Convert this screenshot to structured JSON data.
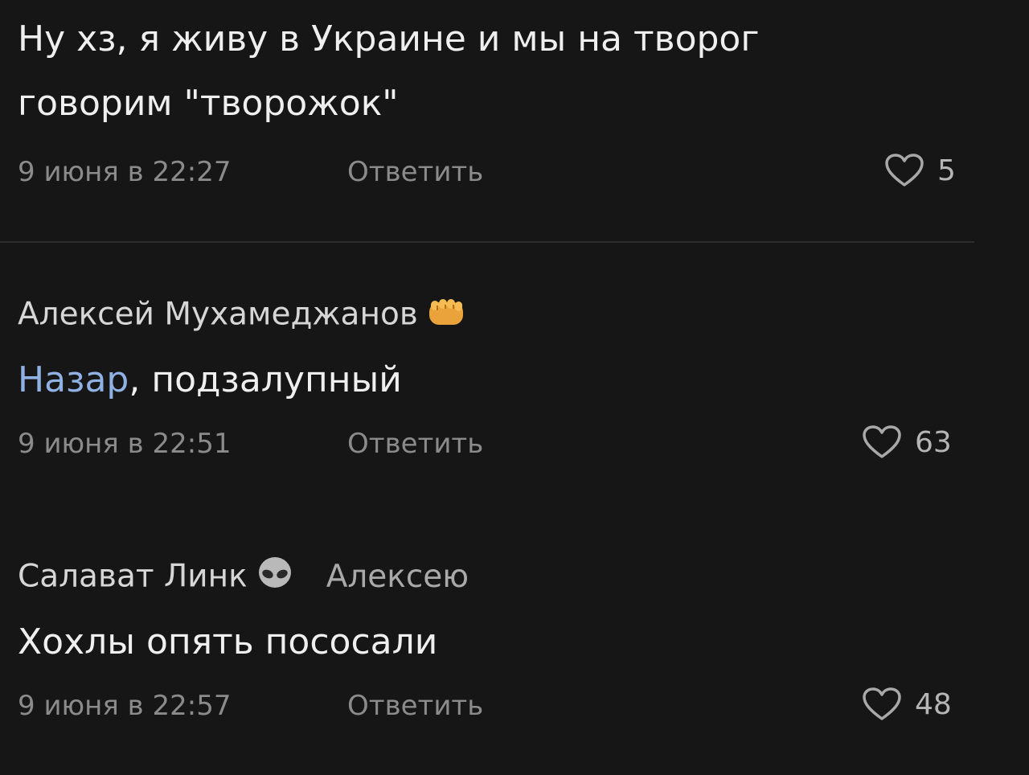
{
  "comments": [
    {
      "text_line1": "Ну хз, я живу в Украине и мы на творог",
      "text_line2": "говорим \"творожок\"",
      "date": "9 июня в 22:27",
      "reply_label": "Ответить",
      "likes": "5"
    },
    {
      "author": "Алексей Мухамеджанов",
      "author_emoji": "fist-bump-icon",
      "mention": "Назар",
      "text": ", подзалупный",
      "date": "9 июня в 22:51",
      "reply_label": "Ответить",
      "likes": "63"
    },
    {
      "author": "Салават Линк",
      "author_emoji": "alien-icon",
      "reply_to": "Алексею",
      "text": "Хохлы опять пососали",
      "date": "9 июня в 22:57",
      "reply_label": "Ответить",
      "likes": "48"
    }
  ],
  "colors": {
    "background": "#161616",
    "text": "#efefef",
    "mention": "#8fb1e3",
    "meta": "#8b8b8b"
  }
}
